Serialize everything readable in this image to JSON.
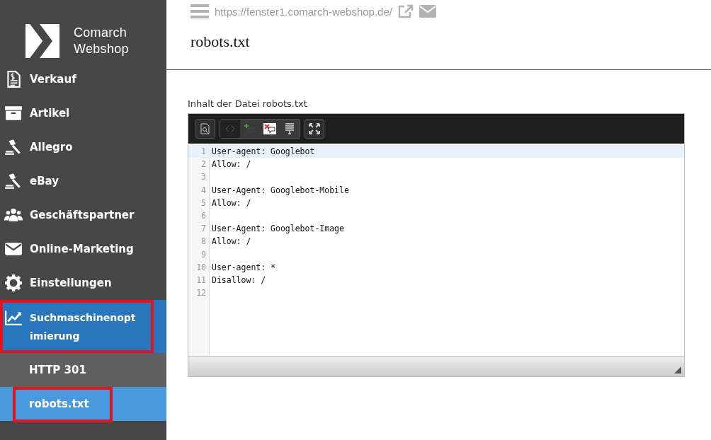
{
  "brand": {
    "line1": "Comarch",
    "line2": "Webshop"
  },
  "sidebar": {
    "items": [
      {
        "label": "Verkauf",
        "selected": false,
        "highlighted": false
      },
      {
        "label": "Artikel",
        "selected": false,
        "highlighted": false
      },
      {
        "label": "Allegro",
        "selected": false,
        "highlighted": false
      },
      {
        "label": "eBay",
        "selected": false,
        "highlighted": false
      },
      {
        "label": "Geschäftspartner",
        "selected": false,
        "highlighted": false
      },
      {
        "label": "Online-Marketing",
        "selected": false,
        "highlighted": false
      },
      {
        "label": "Einstellungen",
        "selected": false,
        "highlighted": false
      },
      {
        "label": "Suchmaschinenopt imierung",
        "selected": true,
        "highlighted": true,
        "children": [
          {
            "label": "HTTP 301",
            "selected": false,
            "highlighted": false
          },
          {
            "label": "robots.txt",
            "selected": true,
            "highlighted": true
          }
        ]
      }
    ]
  },
  "header": {
    "url": "https://fenster1.comarch-webshop.de/",
    "title": "robots.txt"
  },
  "editor": {
    "label": "Inhalt der Datei robots.txt",
    "lines": [
      {
        "number": "1",
        "text": "User-agent: Googlebot",
        "active": true
      },
      {
        "number": "2",
        "text": "Allow: /",
        "active": false
      },
      {
        "number": "3",
        "active": false
      },
      {
        "number": "4",
        "text": "User-Agent: Googlebot-Mobile",
        "active": false
      },
      {
        "number": "5",
        "text": "Allow: /",
        "active": false
      },
      {
        "number": "6",
        "active": false
      },
      {
        "number": "7",
        "text": "User-Agent: Googlebot-Image",
        "active": false
      },
      {
        "number": "8",
        "text": "Allow: /",
        "active": false
      },
      {
        "number": "9",
        "active": false
      },
      {
        "number": "10",
        "text": "User-agent: *",
        "active": false
      },
      {
        "number": "11",
        "text": "Disallow: /",
        "active": false
      },
      {
        "number": "12",
        "active": false
      }
    ]
  }
}
